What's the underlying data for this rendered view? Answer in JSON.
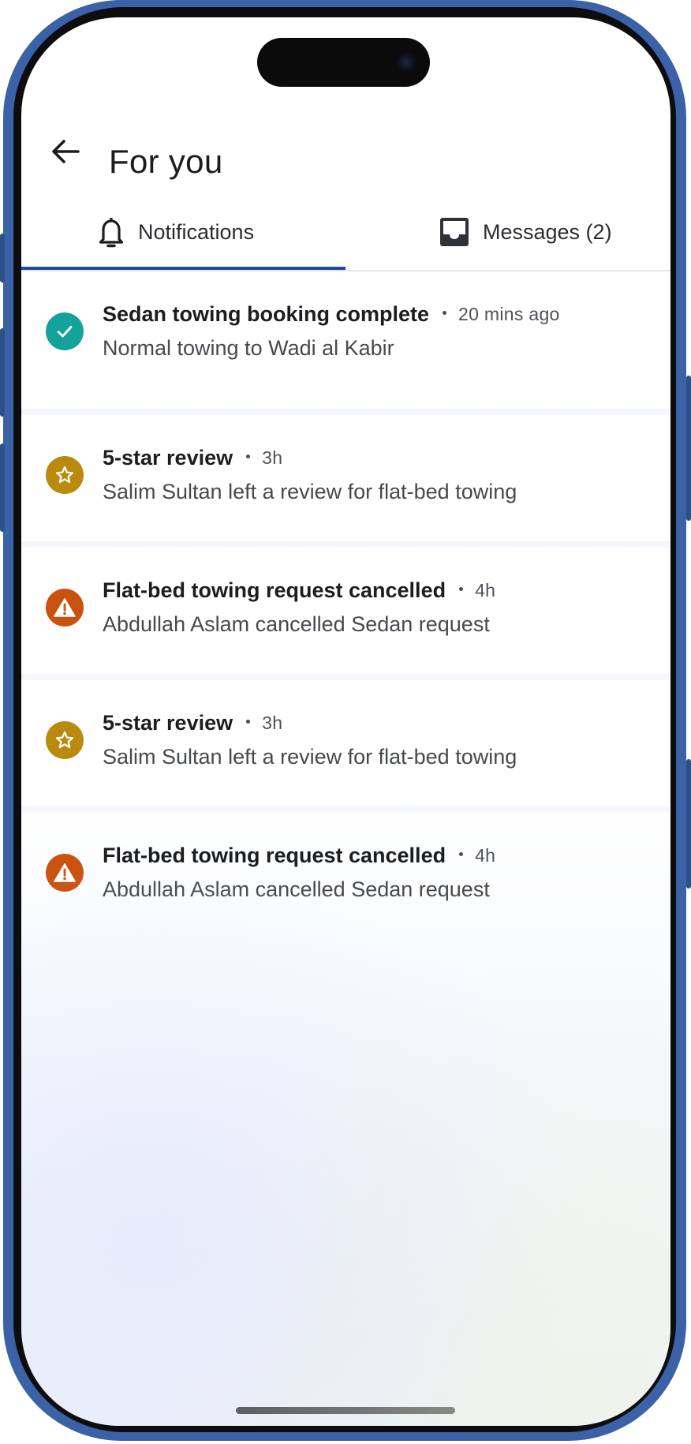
{
  "header": {
    "title": "For you",
    "back_icon": "arrow-left-icon"
  },
  "tabs": [
    {
      "label": "Notifications",
      "icon": "bell-icon",
      "active": true
    },
    {
      "label": "Messages (2)",
      "icon": "inbox-icon",
      "active": false
    }
  ],
  "notifications": [
    {
      "title": "Sedan towing booking complete",
      "time": "20 mins ago",
      "body": "Normal towing to Wadi al Kabir",
      "icon": "check-icon",
      "color": "#13a39a"
    },
    {
      "title": "5-star review",
      "time": "3h",
      "body": "Salim Sultan left a review for flat-bed towing",
      "icon": "star-icon",
      "color": "#b98a0e"
    },
    {
      "title": "Flat-bed towing request cancelled",
      "time": "4h",
      "body": "Abdullah Aslam cancelled Sedan request",
      "icon": "warning-icon",
      "color": "#c9520f"
    },
    {
      "title": "5-star review",
      "time": "3h",
      "body": "Salim Sultan left a review for flat-bed towing",
      "icon": "star-icon",
      "color": "#b98a0e"
    },
    {
      "title": "Flat-bed towing request cancelled",
      "time": "4h",
      "body": "Abdullah Aslam cancelled Sedan request",
      "icon": "warning-icon",
      "color": "#c9520f"
    }
  ],
  "colors": {
    "accent": "#1f4a94",
    "frame": "#3b62a6",
    "success": "#13a39a",
    "review": "#b98a0e",
    "warning": "#c9520f"
  }
}
